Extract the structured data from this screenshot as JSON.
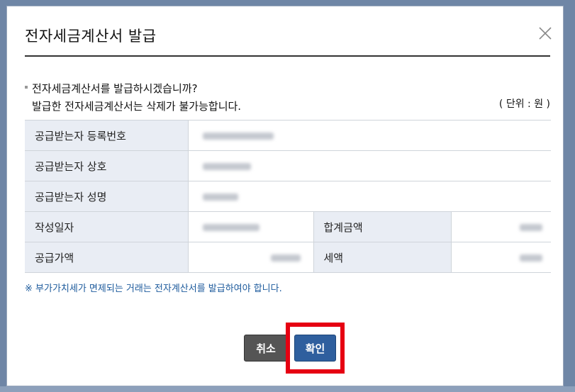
{
  "modal": {
    "title": "전자세금계산서 발급",
    "message_line1": "전자세금계산서를 발급하시겠습니까?",
    "message_line2": "발급한 전자세금계산서는 삭제가 불가능합니다.",
    "unit_label": "( 단위 : 원 )",
    "fields": {
      "recipient_reg_no_label": "공급받는자 등록번호",
      "recipient_company_label": "공급받는자 상호",
      "recipient_name_label": "공급받는자 성명",
      "issue_date_label": "작성일자",
      "total_amount_label": "합계금액",
      "supply_amount_label": "공급가액",
      "tax_amount_label": "세액"
    },
    "note": "※ 부가가치세가 면제되는 거래는 전자계산서를 발급하여야 합니다.",
    "cancel_label": "취소",
    "confirm_label": "확인",
    "close_icon": "close-icon",
    "highlight_color": "#e60012"
  }
}
